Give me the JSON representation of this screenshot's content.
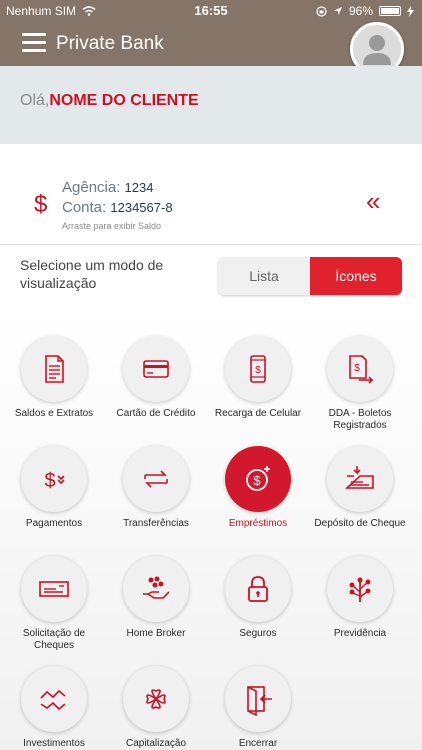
{
  "status_bar": {
    "carrier": "Nenhum SIM",
    "time": "16:55",
    "battery": "96%"
  },
  "nav": {
    "title": "Private Bank"
  },
  "greeting": {
    "hello": "Olá,",
    "name": "NOME DO CLIENTE"
  },
  "account": {
    "agency_label": "Agência:",
    "agency_value": "1234",
    "account_label": "Conta:",
    "account_value": "1234567-8",
    "hint": "Arraste para exibir Saldo"
  },
  "view_mode": {
    "label": "Selecione um modo de visualização",
    "options": [
      "Lista",
      "Ícones"
    ],
    "selected": "Ícones"
  },
  "menu": [
    {
      "label": "Saldos e Extratos",
      "icon": "document-icon"
    },
    {
      "label": "Cartão de Crédito",
      "icon": "credit-card-icon"
    },
    {
      "label": "Recarga de Celular",
      "icon": "phone-recharge-icon"
    },
    {
      "label": "DDA - Boletos Registrados",
      "icon": "bill-transfer-icon"
    },
    {
      "label": "Pagamentos",
      "icon": "payment-icon"
    },
    {
      "label": "Transferências",
      "icon": "transfer-arrows-icon"
    },
    {
      "label": "Empréstimos",
      "icon": "loan-coin-icon",
      "active": true
    },
    {
      "label": "Depósito de Cheque",
      "icon": "cheque-deposit-icon"
    },
    {
      "label": "Solicitação de Cheques",
      "icon": "cheque-icon"
    },
    {
      "label": "Home Broker",
      "icon": "hand-coins-icon"
    },
    {
      "label": "Seguros",
      "icon": "lock-icon"
    },
    {
      "label": "Previdência",
      "icon": "tree-icon"
    },
    {
      "label": "Investimentos",
      "icon": "chart-arrows-icon"
    },
    {
      "label": "Capitalização",
      "icon": "clover-icon"
    },
    {
      "label": "Encerrar",
      "icon": "exit-door-icon"
    }
  ],
  "colors": {
    "brand_red": "#cc1126",
    "nav_bg": "#857468",
    "greeting_bg": "#e3e8ea"
  }
}
